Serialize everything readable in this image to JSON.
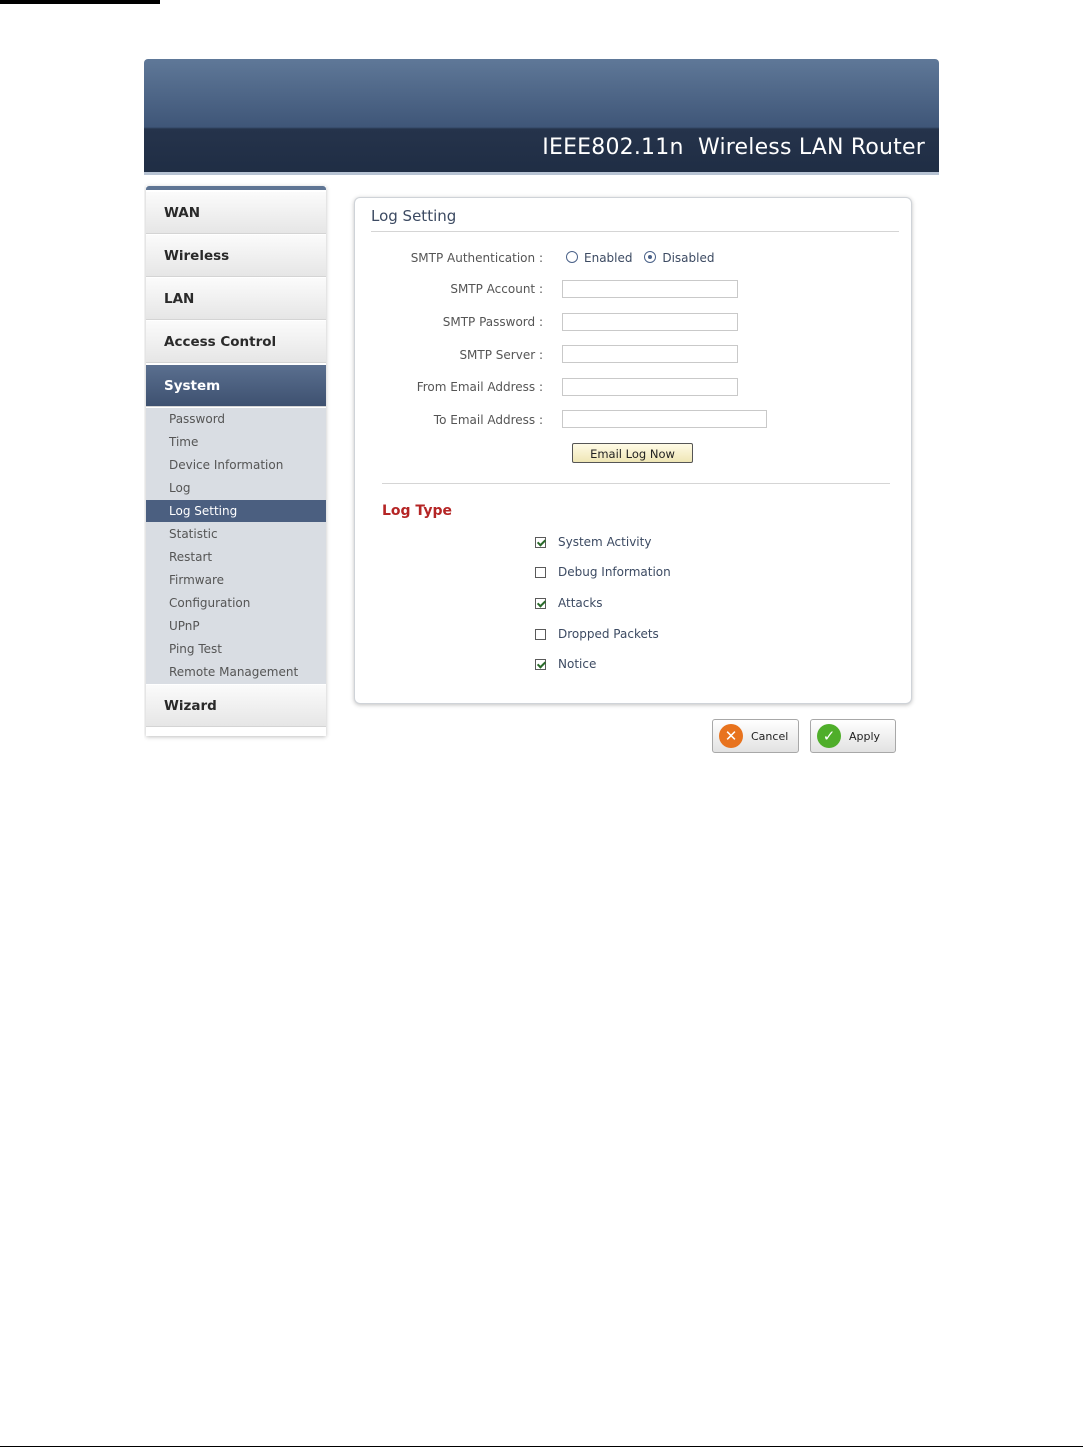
{
  "header": {
    "title": "IEEE802.11n  Wireless LAN Router"
  },
  "sidebar": {
    "sections": [
      {
        "label": "WAN"
      },
      {
        "label": "Wireless"
      },
      {
        "label": "LAN"
      },
      {
        "label": "Access Control"
      },
      {
        "label": "System"
      },
      {
        "label": "Wizard"
      }
    ],
    "submenu": [
      {
        "label": "Password"
      },
      {
        "label": "Time"
      },
      {
        "label": "Device Information"
      },
      {
        "label": "Log"
      },
      {
        "label": "Log Setting"
      },
      {
        "label": "Statistic"
      },
      {
        "label": "Restart"
      },
      {
        "label": "Firmware"
      },
      {
        "label": "Configuration"
      },
      {
        "label": "UPnP"
      },
      {
        "label": "Ping Test"
      },
      {
        "label": "Remote Management"
      }
    ],
    "active_section": "System",
    "active_item": "Log Setting"
  },
  "panel": {
    "title": "Log Setting",
    "smtp_auth": {
      "label": "SMTP Authentication :",
      "option_enabled": "Enabled",
      "option_disabled": "Disabled",
      "selected": "Disabled"
    },
    "fields": [
      {
        "label": "SMTP Account :",
        "value": ""
      },
      {
        "label": "SMTP Password :",
        "value": ""
      },
      {
        "label": "SMTP Server :",
        "value": ""
      },
      {
        "label": "From Email Address :",
        "value": ""
      },
      {
        "label": "To Email Address :",
        "value": ""
      }
    ],
    "email_button": "Email Log Now",
    "log_type": {
      "title": "Log Type",
      "options": [
        {
          "label": "System Activity",
          "checked": true
        },
        {
          "label": "Debug Information",
          "checked": false
        },
        {
          "label": "Attacks",
          "checked": true
        },
        {
          "label": "Dropped Packets",
          "checked": false
        },
        {
          "label": "Notice",
          "checked": true
        }
      ]
    }
  },
  "actions": {
    "cancel": "Cancel",
    "apply": "Apply"
  },
  "colors": {
    "accent": "#4b5f80",
    "log_type_title": "#b52525",
    "cancel_icon": "#e8731e",
    "apply_icon": "#4fae2a"
  },
  "icons": {
    "cancel": "x-icon",
    "apply": "check-icon"
  }
}
